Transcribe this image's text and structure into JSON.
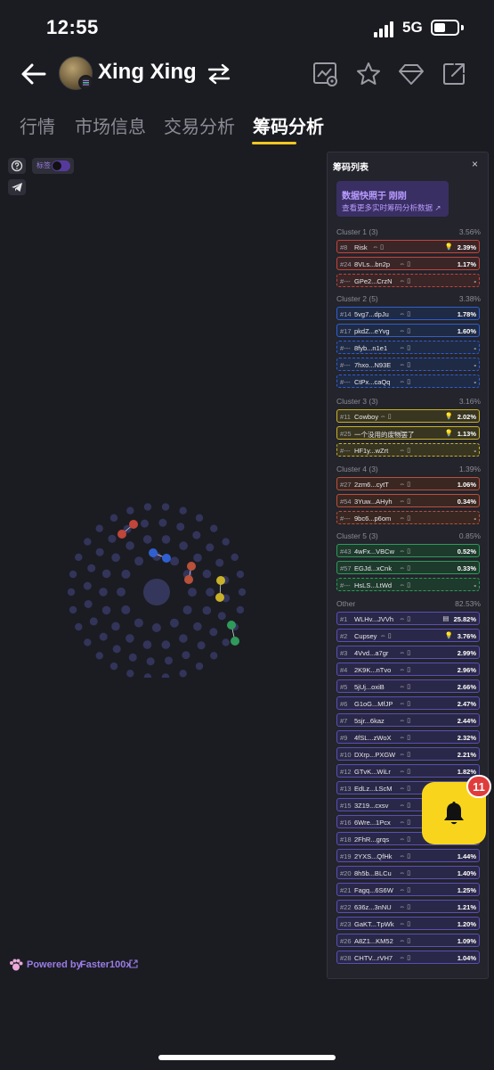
{
  "status_bar": {
    "time": "12:55",
    "network": "5G"
  },
  "header": {
    "token_name": "Xing Xing"
  },
  "tabs": [
    {
      "label": "行情"
    },
    {
      "label": "市场信息"
    },
    {
      "label": "交易分析"
    },
    {
      "label": "筹码分析"
    }
  ],
  "controls": {
    "label_toggle": "标签"
  },
  "powered": {
    "prefix": "Powered by",
    "brand": "Faster100x"
  },
  "panel": {
    "title": "筹码列表",
    "close": "×",
    "snapshot_title": "数据快照于 刚刚",
    "snapshot_link": "查看更多实时筹码分析数据",
    "clusters": [
      {
        "name": "Cluster 1 (3)",
        "pct": "3.56%",
        "color": "#c0453a",
        "bg": "#3a2527",
        "rows": [
          {
            "rank": "#8",
            "addr": "Risk",
            "value": "2.39%",
            "icon": "bulb",
            "dashed": false
          },
          {
            "rank": "#24",
            "addr": "8VLs...bn2p",
            "value": "1.17%",
            "dashed": false
          },
          {
            "rank": "#---",
            "addr": "GPe2...CrzN",
            "value": "-",
            "dashed": true
          }
        ]
      },
      {
        "name": "Cluster 2 (5)",
        "pct": "3.38%",
        "color": "#2f5fd0",
        "bg": "#1f2a45",
        "rows": [
          {
            "rank": "#14",
            "addr": "5vg7...dpJu",
            "value": "1.78%",
            "dashed": false
          },
          {
            "rank": "#17",
            "addr": "pkdZ...eYvg",
            "value": "1.60%",
            "dashed": false
          },
          {
            "rank": "#---",
            "addr": "8fyb...n1e1",
            "value": "-",
            "dashed": true
          },
          {
            "rank": "#---",
            "addr": "7hxo...N93E",
            "value": "-",
            "dashed": true
          },
          {
            "rank": "#---",
            "addr": "CtPx...caQq",
            "value": "-",
            "dashed": true
          }
        ]
      },
      {
        "name": "Cluster 3 (3)",
        "pct": "3.16%",
        "color": "#c9b12a",
        "bg": "#383520",
        "rows": [
          {
            "rank": "#11",
            "addr": "Cowboy",
            "value": "2.02%",
            "icon": "bulb",
            "dashed": false
          },
          {
            "rank": "#25",
            "addr": "一个没用的废物罢了",
            "value": "1.13%",
            "icon": "bulb",
            "dashed": false
          },
          {
            "rank": "#---",
            "addr": "HF1y...wZrt",
            "value": "-",
            "dashed": true
          }
        ]
      },
      {
        "name": "Cluster 4 (3)",
        "pct": "1.39%",
        "color": "#b8503a",
        "bg": "#3a2722",
        "rows": [
          {
            "rank": "#27",
            "addr": "2zm6...cytT",
            "value": "1.06%",
            "dashed": false
          },
          {
            "rank": "#54",
            "addr": "3Yuw...AHyh",
            "value": "0.34%",
            "dashed": false
          },
          {
            "rank": "#---",
            "addr": "9bc6...p6om",
            "value": "-",
            "dashed": true
          }
        ]
      },
      {
        "name": "Cluster 5 (3)",
        "pct": "0.85%",
        "color": "#2f9a5a",
        "bg": "#1e3a2c",
        "rows": [
          {
            "rank": "#43",
            "addr": "4wFx...VBCw",
            "value": "0.52%",
            "dashed": false
          },
          {
            "rank": "#57",
            "addr": "EGJd...xCnk",
            "value": "0.33%",
            "dashed": false
          },
          {
            "rank": "#---",
            "addr": "HsLS...LtWd",
            "value": "-",
            "dashed": true
          }
        ]
      },
      {
        "name": "Other",
        "pct": "82.53%",
        "color": "#5a4fb5",
        "bg": "#2a2848",
        "rows": [
          {
            "rank": "#1",
            "addr": "WLHv...JVVh",
            "value": "25.82%",
            "icon": "doc",
            "dashed": false
          },
          {
            "rank": "#2",
            "addr": "Cupsey",
            "value": "3.76%",
            "icon": "bulb",
            "dashed": false
          },
          {
            "rank": "#3",
            "addr": "4Vvd...a7gr",
            "value": "2.99%",
            "dashed": false
          },
          {
            "rank": "#4",
            "addr": "2K9K...nTvo",
            "value": "2.96%",
            "dashed": false
          },
          {
            "rank": "#5",
            "addr": "5jUj...oxiB",
            "value": "2.66%",
            "dashed": false
          },
          {
            "rank": "#6",
            "addr": "G1oG...MfJP",
            "value": "2.47%",
            "dashed": false
          },
          {
            "rank": "#7",
            "addr": "5sjr...6kaz",
            "value": "2.44%",
            "dashed": false
          },
          {
            "rank": "#9",
            "addr": "4fSL...zWoX",
            "value": "2.32%",
            "dashed": false
          },
          {
            "rank": "#10",
            "addr": "DXrp...PXGW",
            "value": "2.21%",
            "dashed": false
          },
          {
            "rank": "#12",
            "addr": "GTvK...WiLr",
            "value": "1.82%",
            "dashed": false
          },
          {
            "rank": "#13",
            "addr": "EdLz...LScM",
            "value": "",
            "dashed": false
          },
          {
            "rank": "#15",
            "addr": "3Z19...cxsv",
            "value": "",
            "dashed": false
          },
          {
            "rank": "#16",
            "addr": "6Wre...1Pcx",
            "value": "",
            "dashed": false
          },
          {
            "rank": "#18",
            "addr": "2FhR...grqs",
            "value": "",
            "dashed": false
          },
          {
            "rank": "#19",
            "addr": "2YXS...QfHk",
            "value": "1.44%",
            "dashed": false
          },
          {
            "rank": "#20",
            "addr": "8h5b...BLCu",
            "value": "1.40%",
            "dashed": false
          },
          {
            "rank": "#21",
            "addr": "Fagq...6S6W",
            "value": "1.25%",
            "dashed": false
          },
          {
            "rank": "#22",
            "addr": "636z...3nNU",
            "value": "1.21%",
            "dashed": false
          },
          {
            "rank": "#23",
            "addr": "GaKT...TpWk",
            "value": "1.20%",
            "dashed": false
          },
          {
            "rank": "#26",
            "addr": "A8Z1...KM52",
            "value": "1.09%",
            "dashed": false
          },
          {
            "rank": "#28",
            "addr": "CHTV...rVH7",
            "value": "1.04%",
            "dashed": false
          }
        ]
      }
    ]
  },
  "notification": {
    "count": "11"
  }
}
